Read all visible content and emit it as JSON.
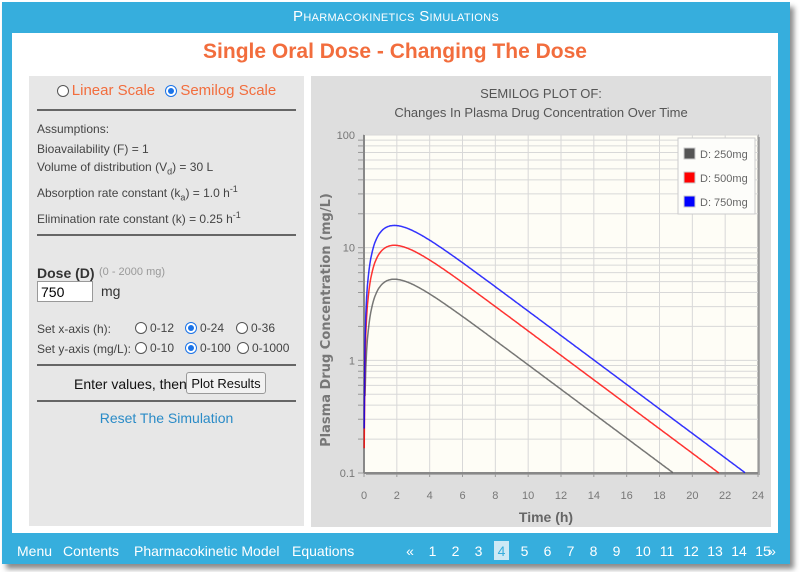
{
  "app_title": "Pharmacokinetics Simulations",
  "page_title": "Single Oral Dose - Changing The Dose",
  "scale_options": [
    {
      "label": "Linear Scale",
      "checked": false
    },
    {
      "label": "Semilog Scale",
      "checked": true
    }
  ],
  "assumptions": {
    "heading": "Assumptions:",
    "bioavailability": "Bioavailability (F) = 1",
    "vd_prefix": "Volume of distribution (V",
    "vd_sub": "d",
    "vd_suffix": ") = 30 L",
    "ka_prefix": "Absorption rate constant (k",
    "ka_sub": "a",
    "ka_suffix": ") = 1.0 h",
    "ka_sup": "-1",
    "k_prefix": "Elimination rate constant (k) = 0.25 h",
    "k_sup": "-1"
  },
  "dose": {
    "label": "Dose (D)",
    "range": "(0 - 2000 mg)",
    "value": "750",
    "unit": "mg"
  },
  "x_axis_setting": {
    "label": "Set x-axis (h):",
    "options": [
      {
        "label": "0-12",
        "checked": false
      },
      {
        "label": "0-24",
        "checked": true
      },
      {
        "label": "0-36",
        "checked": false
      }
    ]
  },
  "y_axis_setting": {
    "label": "Set y-axis (mg/L):",
    "options": [
      {
        "label": "0-10",
        "checked": false
      },
      {
        "label": "0-100",
        "checked": true
      },
      {
        "label": "0-1000",
        "checked": false
      }
    ]
  },
  "enter_values_text": "Enter values, then",
  "plot_button": "Plot Results",
  "reset_link": "Reset The Simulation",
  "chart_data": {
    "type": "line",
    "title": "SEMILOG PLOT OF:",
    "subtitle": "Changes In Plasma Drug Concentration Over Time",
    "xlabel": "Time (h)",
    "ylabel": "Plasma Drug Concentration (mg/L)",
    "xlim": [
      0,
      24
    ],
    "ylim": [
      0.1,
      100
    ],
    "yscale": "log",
    "xticks": [
      "0",
      "2",
      "4",
      "6",
      "8",
      "10",
      "12",
      "14",
      "16",
      "18",
      "20",
      "22",
      "24"
    ],
    "yticks": [
      "0.1",
      "1",
      "10",
      "100"
    ],
    "grid": true,
    "legend_position": "top-right",
    "model": {
      "F": 1,
      "Vd_L": 30,
      "ka_per_h": 1.0,
      "k_per_h": 0.25
    },
    "series": [
      {
        "name": "D: 250mg",
        "dose_mg": 250,
        "color": "#555555",
        "peak_time_h": 1.85,
        "peak_conc_mg_L": 5.25
      },
      {
        "name": "D: 500mg",
        "dose_mg": 500,
        "color": "#ff0000",
        "peak_time_h": 1.85,
        "peak_conc_mg_L": 10.5
      },
      {
        "name": "D: 750mg",
        "dose_mg": 750,
        "color": "#0000ff",
        "peak_time_h": 1.85,
        "peak_conc_mg_L": 15.7
      }
    ]
  },
  "bottom_nav": {
    "links": [
      "Menu",
      "Contents",
      "Pharmacokinetic Model",
      "Equations"
    ],
    "prev": "«",
    "next": "»",
    "pages": [
      "1",
      "2",
      "3",
      "4",
      "5",
      "6",
      "7",
      "8",
      "9",
      "10",
      "11",
      "12",
      "13",
      "14",
      "15"
    ],
    "current_page": "4"
  }
}
